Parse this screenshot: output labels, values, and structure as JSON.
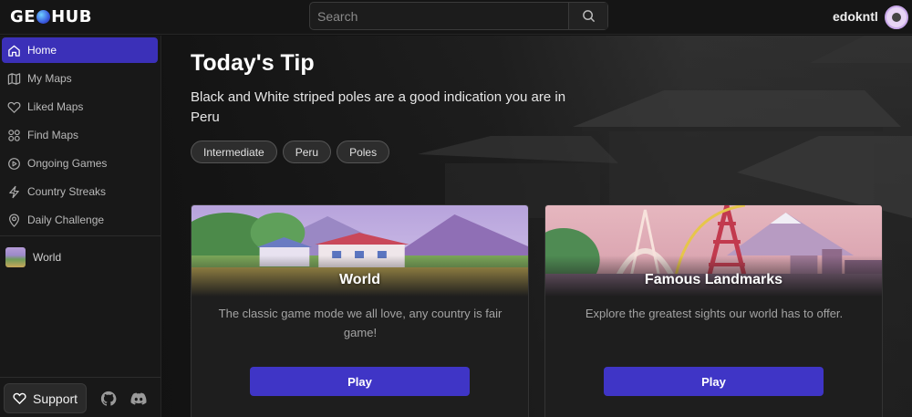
{
  "app": {
    "logo_text_left": "GE",
    "logo_text_right": "HUB"
  },
  "search": {
    "placeholder": "Search"
  },
  "user": {
    "name": "edokntl"
  },
  "sidebar": {
    "items": [
      {
        "label": "Home",
        "icon": "home-icon",
        "active": true
      },
      {
        "label": "My Maps",
        "icon": "map-icon"
      },
      {
        "label": "Liked Maps",
        "icon": "heart-icon"
      },
      {
        "label": "Find Maps",
        "icon": "grid-icon"
      },
      {
        "label": "Ongoing Games",
        "icon": "play-circle-icon"
      },
      {
        "label": "Country Streaks",
        "icon": "lightning-icon"
      },
      {
        "label": "Daily Challenge",
        "icon": "location-pin-icon"
      }
    ],
    "maps": [
      {
        "label": "World"
      }
    ],
    "support_label": "Support"
  },
  "tip": {
    "title": "Today's Tip",
    "text": "Black and White striped poles are a good indication you are in Peru",
    "tags": [
      "Intermediate",
      "Peru",
      "Poles"
    ]
  },
  "cards": [
    {
      "title": "World",
      "description": "The classic game mode we all love, any country is fair game!",
      "button": "Play"
    },
    {
      "title": "Famous Landmarks",
      "description": "Explore the greatest sights our world has to offer.",
      "button": "Play"
    }
  ],
  "colors": {
    "accent": "#3f35c6",
    "active_nav": "#3b30b8"
  }
}
